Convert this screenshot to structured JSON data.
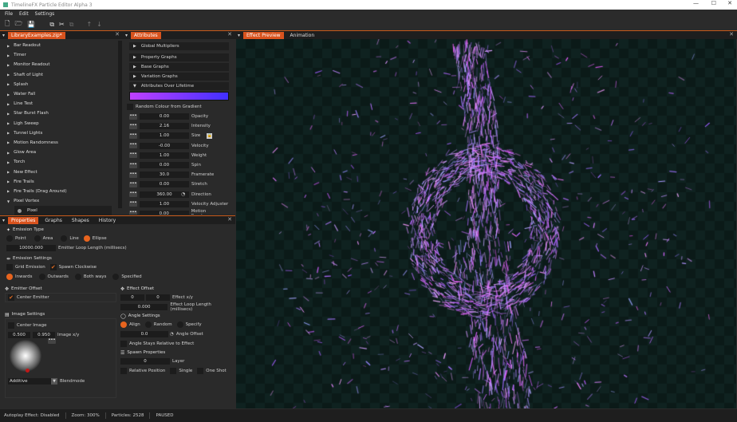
{
  "window": {
    "title": "TimelineFX Particle Editor Alpha 3"
  },
  "menu": [
    "File",
    "Edit",
    "Settings"
  ],
  "library": {
    "tab": "LibraryExamples.zip*",
    "items": [
      "Bar Readout",
      "Timer",
      "Monitor Readout",
      "Shaft of Light",
      "Splash",
      "Water Fall",
      "Line Test",
      "Star Burst Flash",
      "Ligh Sweep",
      "Tunnel Lights",
      "Motion Randomness",
      "Glow Area",
      "Torch",
      "New Effect",
      "Fire Trails",
      "Fire Trails (Drag Around)",
      "Pixel Vortex"
    ],
    "child": "Pixel"
  },
  "attributes": {
    "tab": "Attributes",
    "sections": [
      "Global Multipliers",
      "Property Graphs",
      "Base Graphs",
      "Variation Graphs",
      "Attributes Over Lifetime"
    ],
    "gradient": [
      "#c040ff",
      "#4030ff"
    ],
    "random_colour": "Random Colour from Gradient",
    "rows": [
      {
        "value": "0.00",
        "label": "Opacity"
      },
      {
        "value": "2.16",
        "label": "Intensity"
      },
      {
        "value": "1.00",
        "label": "Size"
      },
      {
        "value": "-0.00",
        "label": "Velocity"
      },
      {
        "value": "1.00",
        "label": "Weight"
      },
      {
        "value": "0.00",
        "label": "Spin"
      },
      {
        "value": "30.0",
        "label": "Framerate"
      },
      {
        "value": "0.00",
        "label": "Stretch"
      },
      {
        "value": "360.00",
        "label": "Direction"
      },
      {
        "value": "1.00",
        "label": "Velocity Adjuster"
      },
      {
        "value": "0.00",
        "label": "Motion Randomness"
      }
    ]
  },
  "preview": {
    "tabs": [
      "Effect Preview",
      "Animation"
    ]
  },
  "properties": {
    "tabs": [
      "Properties",
      "Graphs",
      "Shapes",
      "History"
    ],
    "emission_type": {
      "title": "Emission Type",
      "options": [
        "Point",
        "Area",
        "Line",
        "Ellipse"
      ],
      "selected": "Ellipse",
      "loop_value": "10000.000",
      "loop_label": "Emitter Loop Length (millisecs)"
    },
    "emission_settings": {
      "title": "Emission Settings",
      "grid": "Grid Emission",
      "spawn_cw": "Spawn Clockwise",
      "directions": [
        "Inwards",
        "Outwards",
        "Both ways",
        "Specified"
      ],
      "selected": "Inwards"
    },
    "emitter_offset": {
      "title": "Emitter Offset",
      "center": "Center Emitter"
    },
    "image_settings": {
      "title": "Image Settings",
      "center": "Center Image",
      "x": "0.500",
      "y": "0.950",
      "xy_label": "Image x/y",
      "blendmode": "Additive",
      "blend_label": "Blendmode"
    },
    "effect_offset": {
      "title": "Effect Offset",
      "x": "0",
      "y": "0",
      "xy_label": "Effect x/y",
      "loop": "0.000",
      "loop_label": "Effect Loop Length (millisecs)"
    },
    "angle_settings": {
      "title": "Angle Settings",
      "options": [
        "Align",
        "Random",
        "Specify"
      ],
      "selected": "Align",
      "offset": "0.0",
      "offset_label": "Angle Offset",
      "relative": "Angle Stays Relative to Effect"
    },
    "spawn": {
      "title": "Spawn Properties",
      "layer": "0",
      "layer_label": "Layer",
      "relative": "Relative Position",
      "single": "Single",
      "oneshot": "One Shot"
    }
  },
  "status": {
    "autoplay": "Autoplay Effect: Disabled",
    "zoom": "Zoom: 300%",
    "particles": "Particles: 2528",
    "state": "PAUSED"
  },
  "colors": {
    "accent": "#d9531e",
    "particle": "#a070ff"
  }
}
